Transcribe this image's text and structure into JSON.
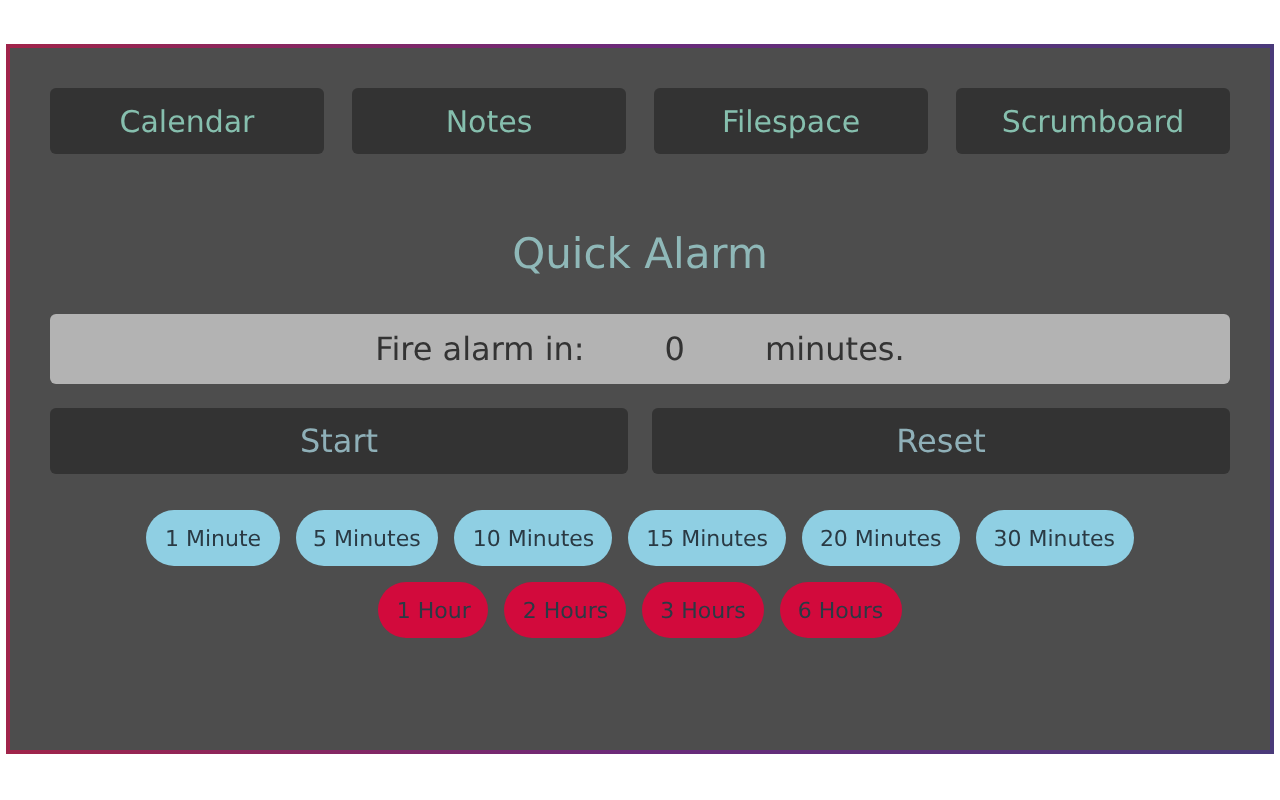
{
  "nav": [
    "Calendar",
    "Notes",
    "Filespace",
    "Scrumboard"
  ],
  "title": "Quick Alarm",
  "alarm": {
    "prefix": "Fire alarm in:",
    "value": "0",
    "suffix": "minutes."
  },
  "actions": [
    "Start",
    "Reset"
  ],
  "preset_rows": [
    [
      {
        "label": "1 Minute",
        "color": "#8fcfe3"
      },
      {
        "label": "5 Minutes",
        "color": "#8fcfe3"
      },
      {
        "label": "10 Minutes",
        "color": "#8fcfe3"
      },
      {
        "label": "15 Minutes",
        "color": "#8fcfe3"
      },
      {
        "label": "20 Minutes",
        "color": "#8fcfe3"
      },
      {
        "label": "30 Minutes",
        "color": "#8fcfe3"
      }
    ],
    [
      {
        "label": "1 Hour",
        "color": "#d20a3c"
      },
      {
        "label": "2 Hours",
        "color": "#d20a3c"
      },
      {
        "label": "3 Hours",
        "color": "#d20a3c"
      },
      {
        "label": "6 Hours",
        "color": "#d20a3c"
      }
    ]
  ]
}
